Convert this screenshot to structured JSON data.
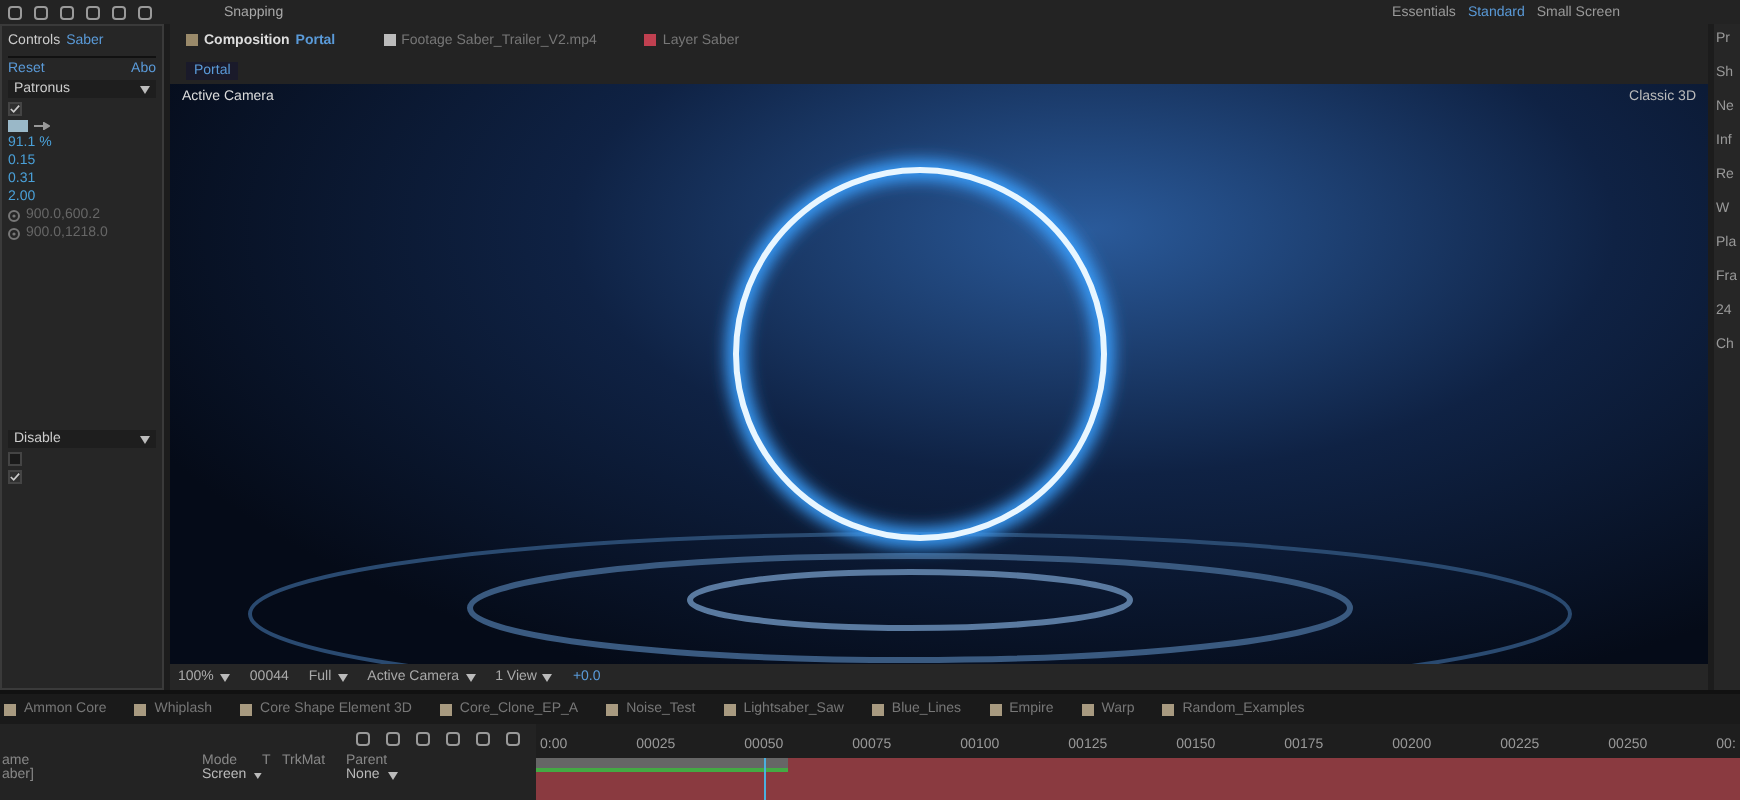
{
  "toolbar": {
    "snapping_label": "Snapping",
    "snapping_on": true,
    "workspaces": [
      {
        "label": "Essentials",
        "selected": false
      },
      {
        "label": "Standard",
        "selected": true
      },
      {
        "label": "Small Screen",
        "selected": false
      }
    ]
  },
  "effect_controls": {
    "title": "Controls",
    "layer": "Saber",
    "reset": "Reset",
    "about": "Abo",
    "preset": "Patronus",
    "enabled": true,
    "values": [
      "91.1 %",
      "0.15",
      "0.31",
      "2.00"
    ],
    "points": [
      "900.0,600.2",
      "900.0,1218.0"
    ],
    "mode": "Disable",
    "toggles": [
      {
        "checked": false
      },
      {
        "checked": true
      }
    ]
  },
  "composition": {
    "tabs": [
      {
        "kind": "composition",
        "label": "Composition",
        "name": "Portal",
        "selected": true
      },
      {
        "kind": "footage",
        "label": "Footage Saber_Trailer_V2.mp4",
        "selected": false
      },
      {
        "kind": "layer",
        "label": "Layer Saber",
        "selected": false
      }
    ],
    "breadcrumb": "Portal",
    "camera_label": "Active Camera",
    "renderer": "Classic 3D",
    "viewer_bar": {
      "zoom": "100%",
      "timecode": "00044",
      "resolution": "Full",
      "view": "Active Camera",
      "layout": "1 View",
      "exposure": "+0.0"
    }
  },
  "right_panel": {
    "labels": [
      "Pr",
      "Sh",
      "Ne",
      "Inf",
      "Re",
      "W",
      "Pla",
      "Fra",
      "24",
      "Ch"
    ]
  },
  "comp_tabs": [
    {
      "label": "Ammon Core"
    },
    {
      "label": "Whiplash"
    },
    {
      "label": "Core Shape Element 3D"
    },
    {
      "label": "Core_Clone_EP_A"
    },
    {
      "label": "Noise_Test"
    },
    {
      "label": "Lightsaber_Saw"
    },
    {
      "label": "Blue_Lines"
    },
    {
      "label": "Empire"
    },
    {
      "label": "Warp"
    },
    {
      "label": "Random_Examples"
    }
  ],
  "timeline": {
    "columns": [
      "ame",
      "Mode",
      "T",
      "TrkMat",
      "Parent"
    ],
    "layer": {
      "name": "aber]",
      "mode": "Screen",
      "parent": "None"
    },
    "ticks": [
      "0:00",
      "00025",
      "00050",
      "00075",
      "00100",
      "00125",
      "00150",
      "00175",
      "00200",
      "00225",
      "00250",
      "00:"
    ],
    "playhead": {
      "level": 0.19
    },
    "work_area": {
      "level": 0.21
    }
  }
}
